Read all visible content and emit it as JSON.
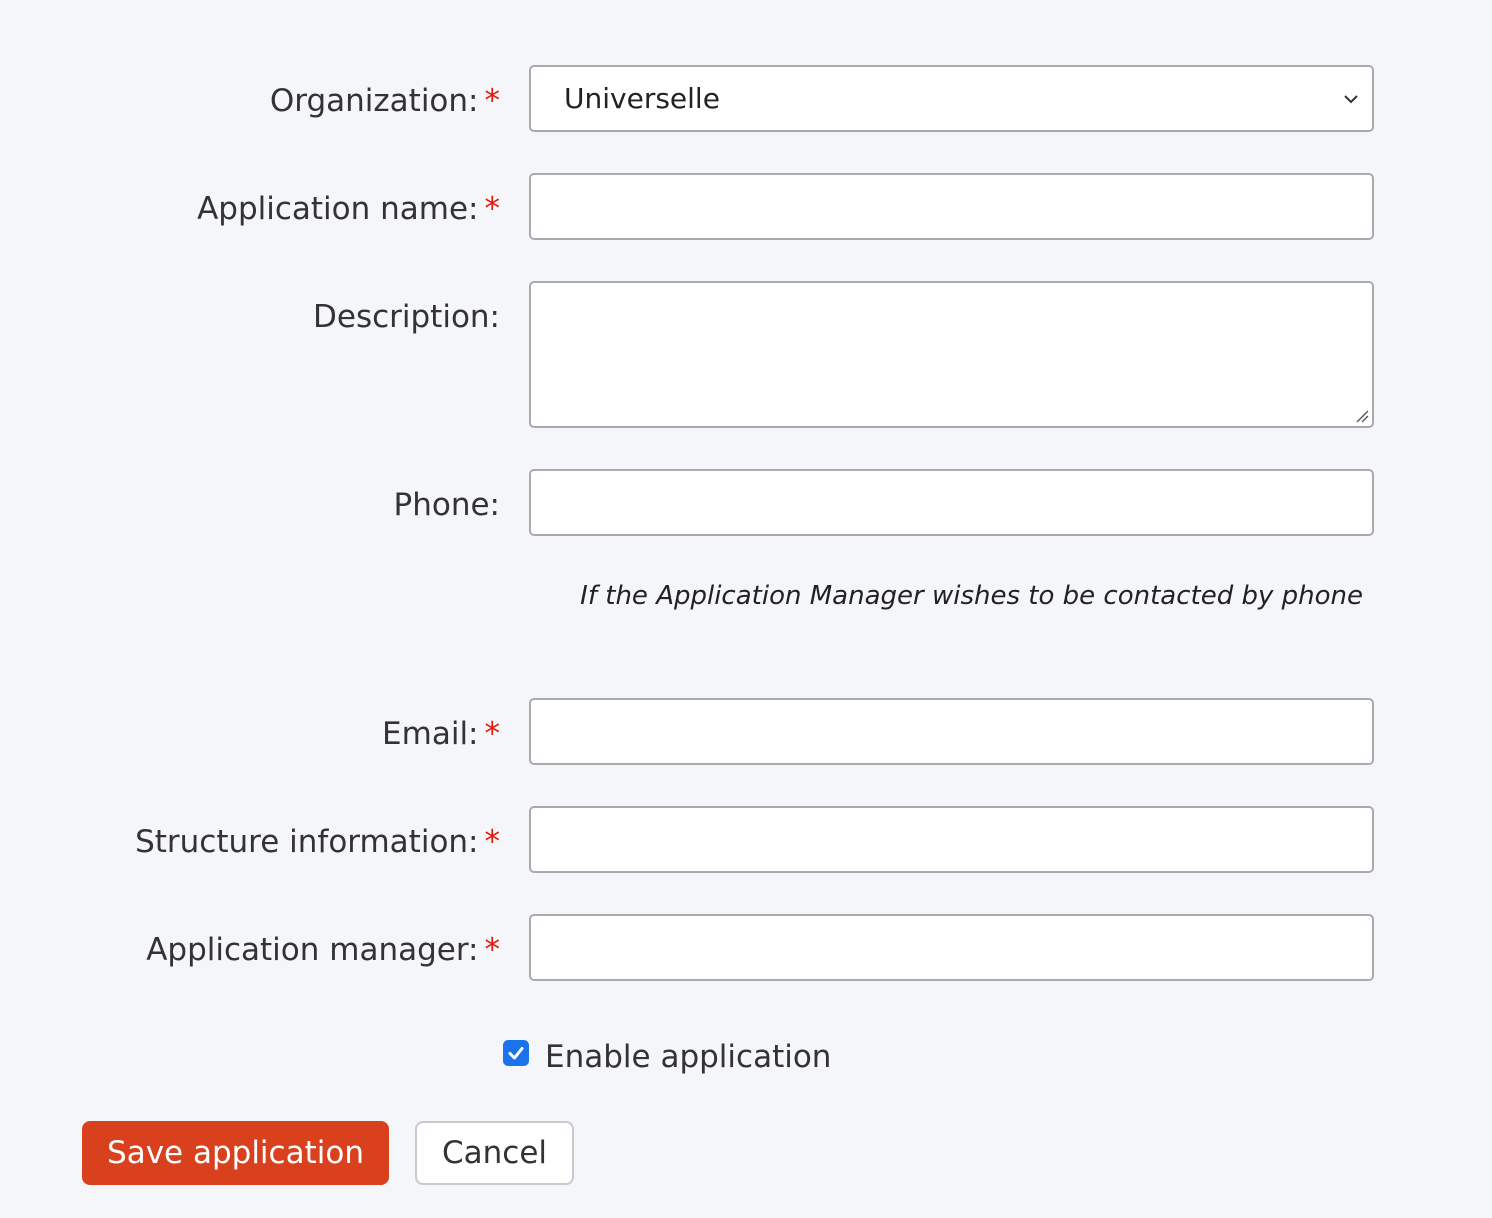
{
  "form": {
    "organization": {
      "label": "Organization:",
      "required_mark": "*",
      "value": "Universelle"
    },
    "application_name": {
      "label": "Application name:",
      "required_mark": "*",
      "value": ""
    },
    "description": {
      "label": "Description:",
      "value": ""
    },
    "phone": {
      "label": "Phone:",
      "value": "",
      "help_text": "If the Application Manager wishes to be contacted by phone"
    },
    "email": {
      "label": "Email:",
      "required_mark": "*",
      "value": ""
    },
    "structure_information": {
      "label": "Structure information:",
      "required_mark": "*",
      "value": ""
    },
    "application_manager": {
      "label": "Application manager:",
      "required_mark": "*",
      "value": ""
    },
    "enable_application": {
      "label": "Enable application",
      "checked": true
    }
  },
  "actions": {
    "save_label": "Save application",
    "cancel_label": "Cancel"
  },
  "colors": {
    "background": "#f5f6fa",
    "required": "#e3170a",
    "primary_button": "#d9411e",
    "checkbox": "#1a73e8"
  },
  "icons": {
    "select_arrow": "chevron-down-icon",
    "textarea_resize": "resize-grip-icon",
    "checkbox_mark": "checkmark-icon"
  }
}
